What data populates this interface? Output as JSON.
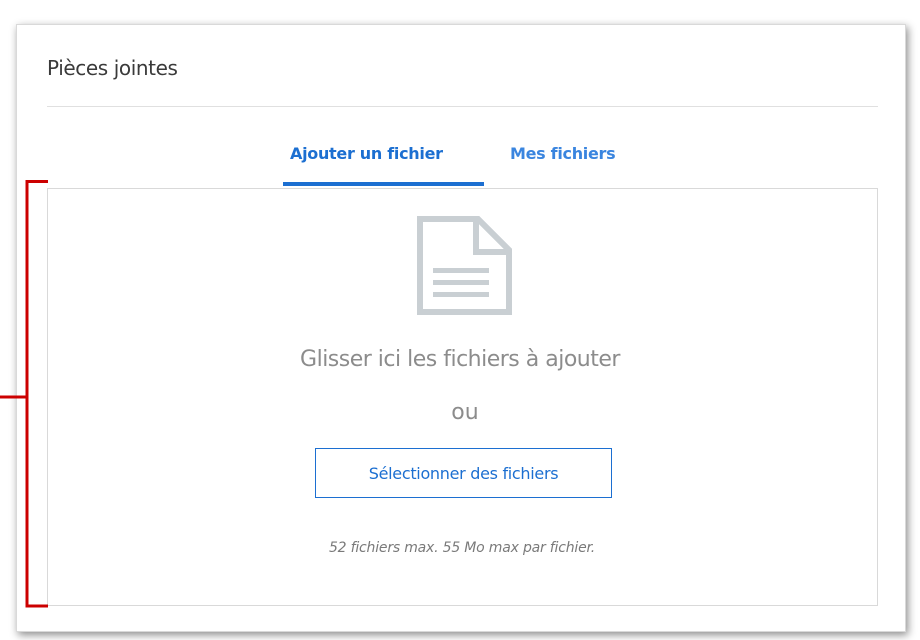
{
  "panel": {
    "title": "Pièces jointes"
  },
  "tabs": [
    {
      "label": "Ajouter un fichier",
      "active": true
    },
    {
      "label": "Mes fichiers",
      "active": false
    }
  ],
  "dropzone": {
    "icon": "document-icon",
    "drop_text": "Glisser ici les fichiers à ajouter",
    "or_text": "ou",
    "select_button_label": "Sélectionner des fichiers",
    "limits_text": "52 fichiers max. 55 Mo max par fichier."
  },
  "colors": {
    "accent": "#1c6fd1",
    "annotation": "#cc0000",
    "icon_gray": "#c9cfd3",
    "border": "#d9d9d9"
  }
}
